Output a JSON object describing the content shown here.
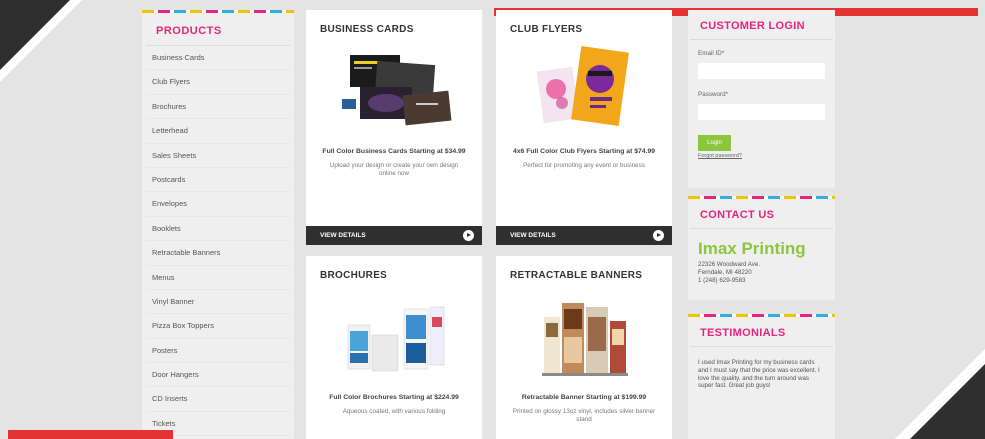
{
  "sidebar": {
    "heading": "PRODUCTS",
    "items": [
      "Business Cards",
      "Club Flyers",
      "Brochures",
      "Letterhead",
      "Sales Sheets",
      "Postcards",
      "Envelopes",
      "Booklets",
      "Retractable Banners",
      "Menus",
      "Vinyl Banner",
      "Pizza Box Toppers",
      "Posters",
      "Door Hangers",
      "CD Inserts",
      "Tickets"
    ]
  },
  "cards": [
    {
      "heading": "BUSINESS CARDS",
      "title": "Full Color Business Cards Starting at $34.99",
      "desc": "Upload your design or create your own design online now",
      "button": "VIEW DETAILS"
    },
    {
      "heading": "CLUB FLYERS",
      "title": "4x6 Full Color Club Flyers Starting at $74.99",
      "desc": "Perfect for promoting any event or business",
      "button": "VIEW DETAILS"
    },
    {
      "heading": "BROCHURES",
      "title": "Full Color Brochures Starting at $224.99",
      "desc": "Aqueous coated, with various folding"
    },
    {
      "heading": "RETRACTABLE BANNERS",
      "title": "Retractable Banner Starting at $199.99",
      "desc": "Printed on glossy 13oz vinyl, includes silver banner stand"
    }
  ],
  "login": {
    "heading": "CUSTOMER LOGIN",
    "email_label": "Email ID*",
    "password_label": "Password*",
    "button": "Login",
    "forgot": "Forgot password?"
  },
  "contact": {
    "heading": "CONTACT US",
    "brand": "Imax Printing",
    "address1": "22326 Woodward Ave.",
    "address2": "Ferndale, MI 48220",
    "phone": "1 (248) 629-9583"
  },
  "testimonials": {
    "heading": "TESTIMONIALS",
    "text": "I used Imax Printing for my business cards and I must say that the price was excellent. I love the quality, and the turn around was super fast. Great job guys!"
  },
  "colors": {
    "accent_pink": "#e5257f",
    "accent_green": "#8cc63f",
    "accent_red": "#e33333",
    "dark": "#2f2f2f"
  }
}
